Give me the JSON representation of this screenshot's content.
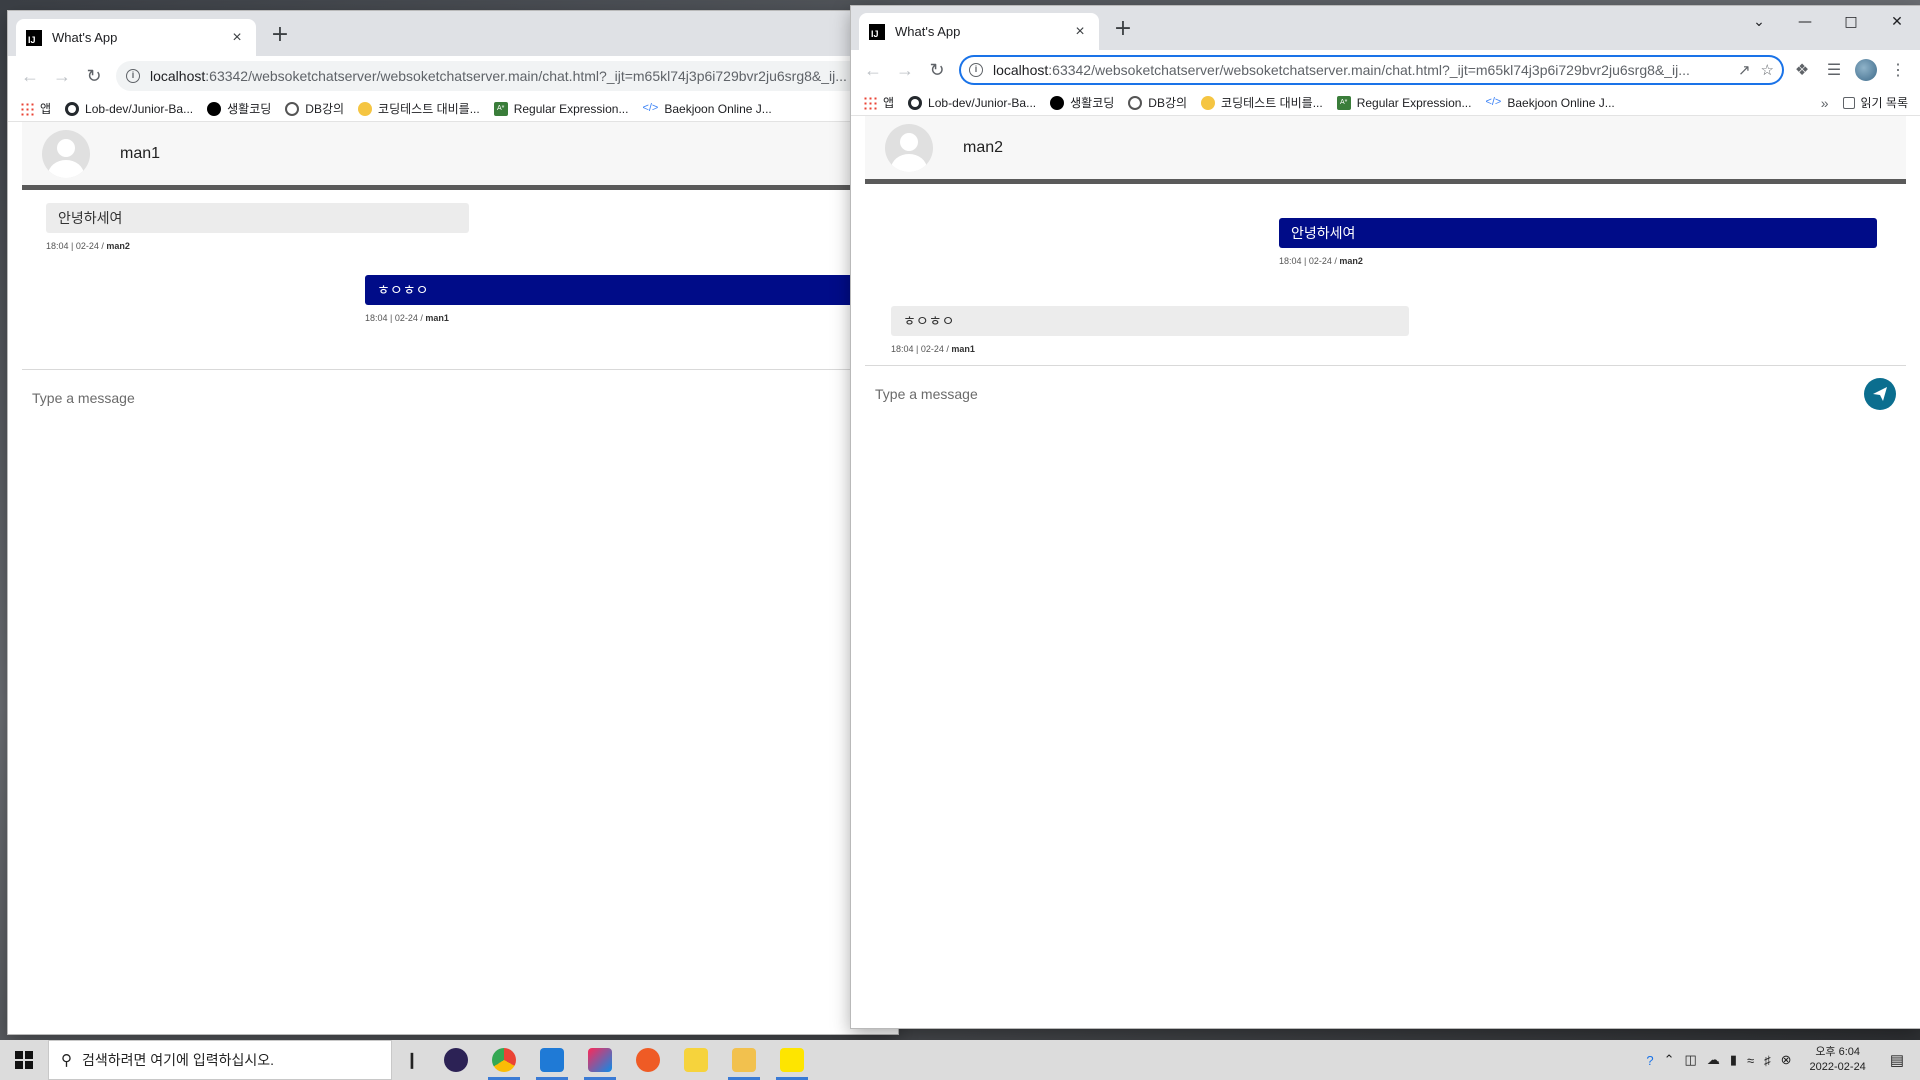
{
  "browser": {
    "tab_title": "What's App",
    "tab_close": "×",
    "new_tab": "+",
    "url_host": "localhost",
    "url_rest_left": ":63342/websoketchatserver/websoketchatserver.main/chat.html?_ijt=m65kl74j3p6i729bvr2ju6srg8&_ij...",
    "url_rest_right": ":63342/websoketchatserver/websoketchatserver.main/chat.html?_ijt=m65kl74j3p6i729bvr2ju6srg8&_ij...",
    "bookmarks": [
      {
        "label": "앱",
        "icon": "apps-icon"
      },
      {
        "label": "Lob-dev/Junior-Ba...",
        "icon": "github-icon"
      },
      {
        "label": "생활코딩",
        "icon": "black-circle-icon"
      },
      {
        "label": "DB강의",
        "icon": "db-icon"
      },
      {
        "label": "코딩테스트 대비를...",
        "icon": "yellow-circle-icon"
      },
      {
        "label": "Regular Expression...",
        "icon": "regex-icon"
      },
      {
        "label": "Baekjoon Online J...",
        "icon": "code-icon"
      }
    ],
    "bookmarks_more": "»",
    "reading_list": "읽기 목록"
  },
  "left_chat": {
    "username": "man1",
    "messages": [
      {
        "text": "안녕하세여",
        "direction": "in",
        "time": "18:04 | 02-24 / ",
        "sender": "man2"
      },
      {
        "text": "ㅎㅇㅎㅇ",
        "direction": "out",
        "time": "18:04 | 02-24 / ",
        "sender": "man1"
      }
    ],
    "input_placeholder": "Type a message"
  },
  "right_chat": {
    "username": "man2",
    "messages": [
      {
        "text": "안녕하세여",
        "direction": "out",
        "time": "18:04 | 02-24 / ",
        "sender": "man2"
      },
      {
        "text": "ㅎㅇㅎㅇ",
        "direction": "in",
        "time": "18:04 | 02-24 / ",
        "sender": "man1"
      }
    ],
    "input_placeholder": "Type a message"
  },
  "taskbar": {
    "search_placeholder": "검색하려면 여기에 입력하십시오.",
    "clock_period_time": "오후 6:04",
    "clock_date": "2022-02-24"
  },
  "colors": {
    "outgoing_bubble": "#000c88",
    "incoming_bubble": "#ececec",
    "send_button": "#0b6e8f",
    "omnibox_focus": "#1a73e8"
  }
}
